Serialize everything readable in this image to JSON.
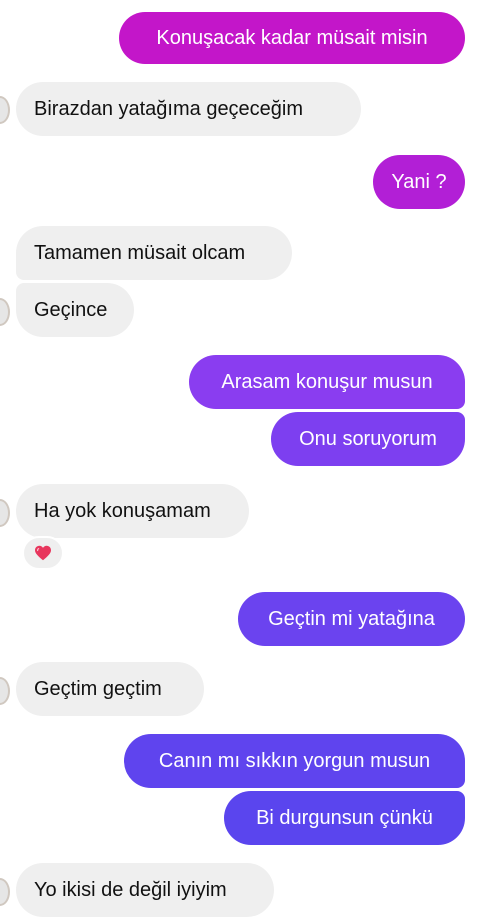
{
  "messages": [
    {
      "side": "out",
      "text": "Konuşacak kadar müsait misin"
    },
    {
      "side": "in",
      "text": "Birazdan yatağıma geçeceğim"
    },
    {
      "side": "out",
      "text": "Yani ?"
    },
    {
      "side": "in",
      "text": "Tamamen müsait olcam"
    },
    {
      "side": "in",
      "text": "Geçince"
    },
    {
      "side": "out",
      "text": "Arasam konuşur musun"
    },
    {
      "side": "out",
      "text": "Onu soruyorum"
    },
    {
      "side": "in",
      "text": "Ha yok konuşamam"
    },
    {
      "side": "out",
      "text": "Geçtin mi yatağına"
    },
    {
      "side": "in",
      "text": "Geçtim geçtim"
    },
    {
      "side": "out",
      "text": "Canın mı sıkkın yorgun musun"
    },
    {
      "side": "out",
      "text": "Bi durgunsun çünkü"
    },
    {
      "side": "in",
      "text": "Yo ikisi de değil iyiyim"
    }
  ],
  "reaction": {
    "icon": "heart-icon",
    "color": "#e8365d"
  },
  "colors": {
    "incoming_bubble": "#efefef",
    "outgoing_magenta": "#c316c9",
    "outgoing_purple": "#8a3df0",
    "outgoing_indigo": "#5f44ee"
  }
}
